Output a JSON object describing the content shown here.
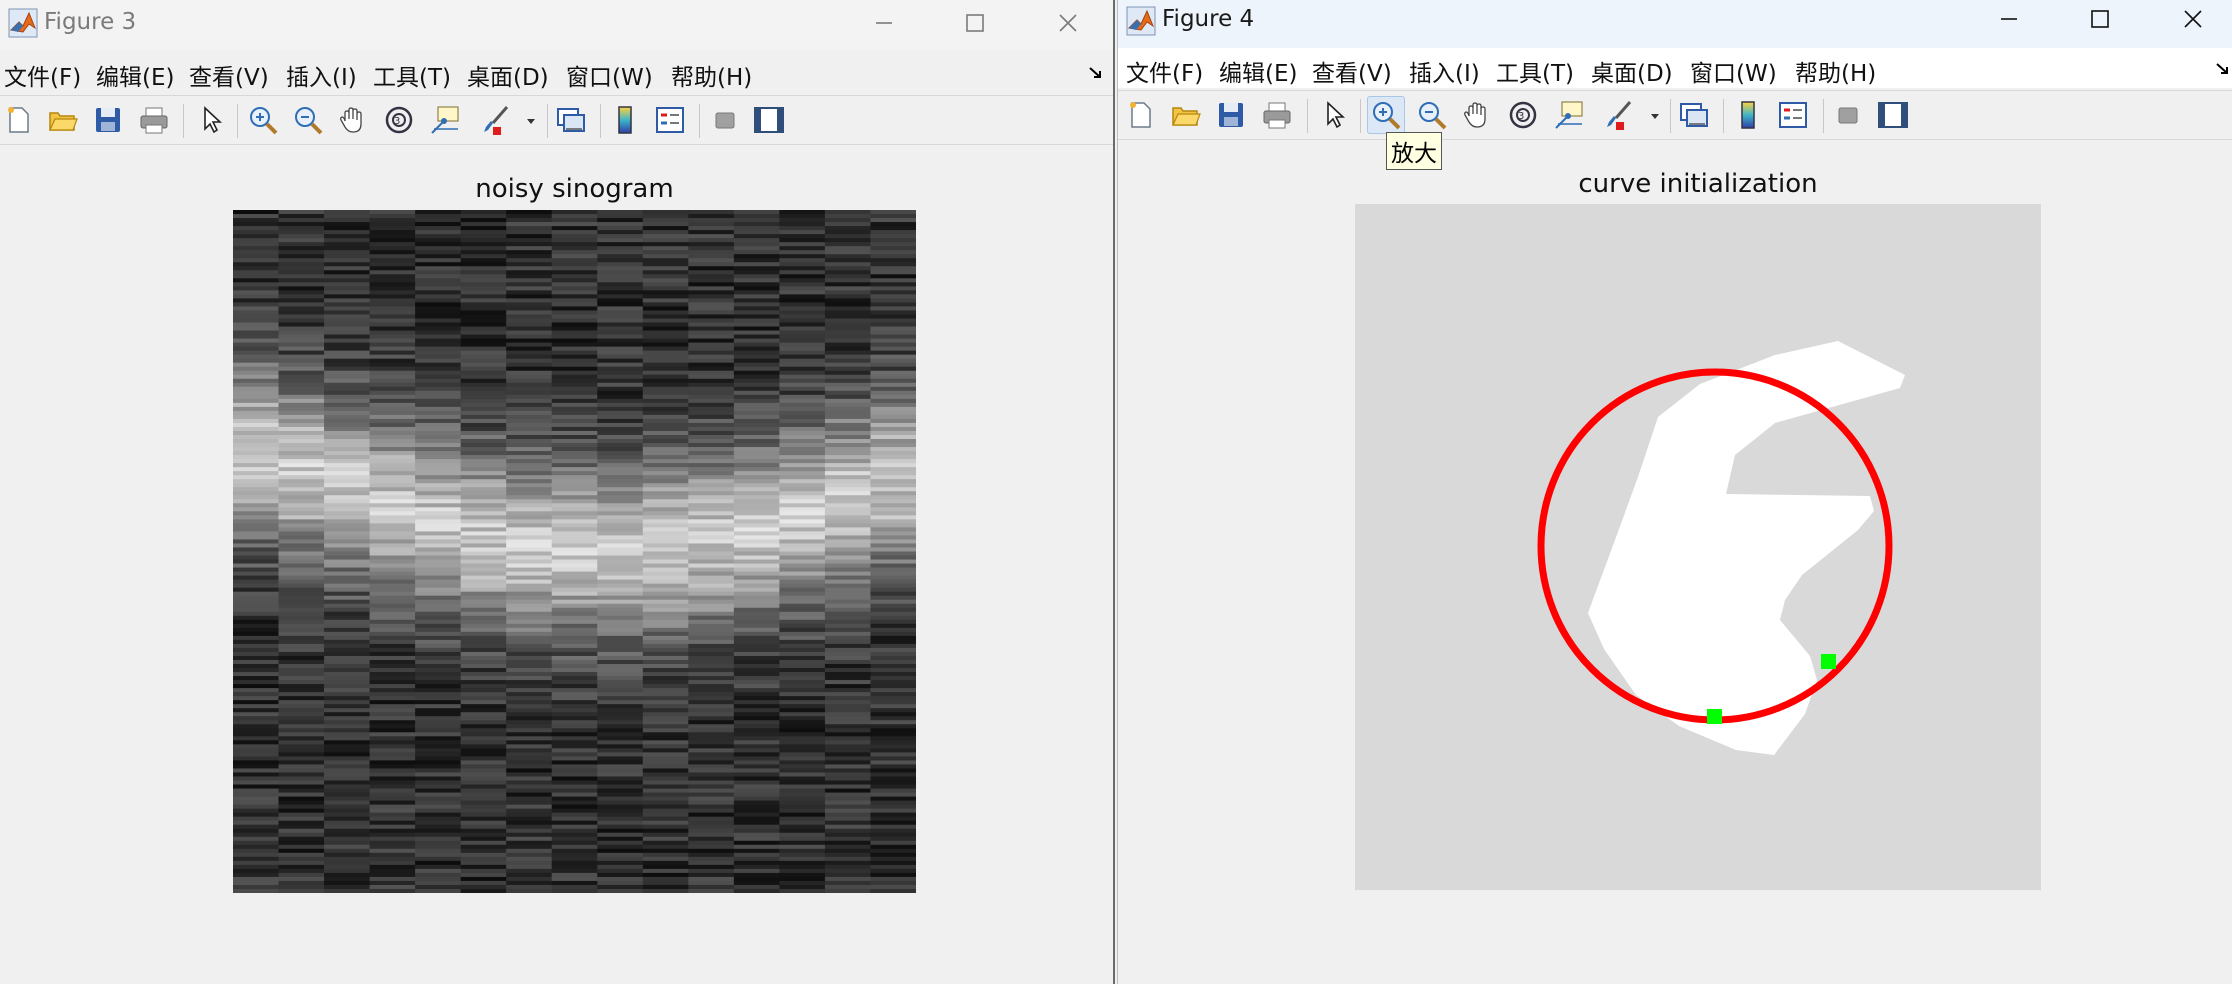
{
  "figure3": {
    "title": "Figure 3",
    "menu": [
      "文件(F)",
      "编辑(E)",
      "查看(V)",
      "插入(I)",
      "工具(T)",
      "桌面(D)",
      "窗口(W)",
      "帮助(H)"
    ],
    "plot_title": "noisy sinogram"
  },
  "figure4": {
    "title": "Figure 4",
    "menu": [
      "文件(F)",
      "编辑(E)",
      "查看(V)",
      "插入(I)",
      "工具(T)",
      "桌面(D)",
      "窗口(W)",
      "帮助(H)"
    ],
    "plot_title": "curve initialization",
    "tooltip": "放大"
  },
  "colors": {
    "curve": "#ff0000",
    "marker": "#00ff00",
    "shape": "#ffffff",
    "axes_bg": "#d9d9d9"
  },
  "icons": [
    "new-figure-icon",
    "open-file-icon",
    "save-icon",
    "print-icon",
    "pointer-icon",
    "zoom-in-icon",
    "zoom-out-icon",
    "pan-hand-icon",
    "rotate-3d-icon",
    "data-cursor-icon",
    "brush-icon",
    "link-plot-icon",
    "colorbar-icon",
    "legend-icon",
    "hide-plot-tools-icon",
    "show-plot-tools-icon"
  ]
}
